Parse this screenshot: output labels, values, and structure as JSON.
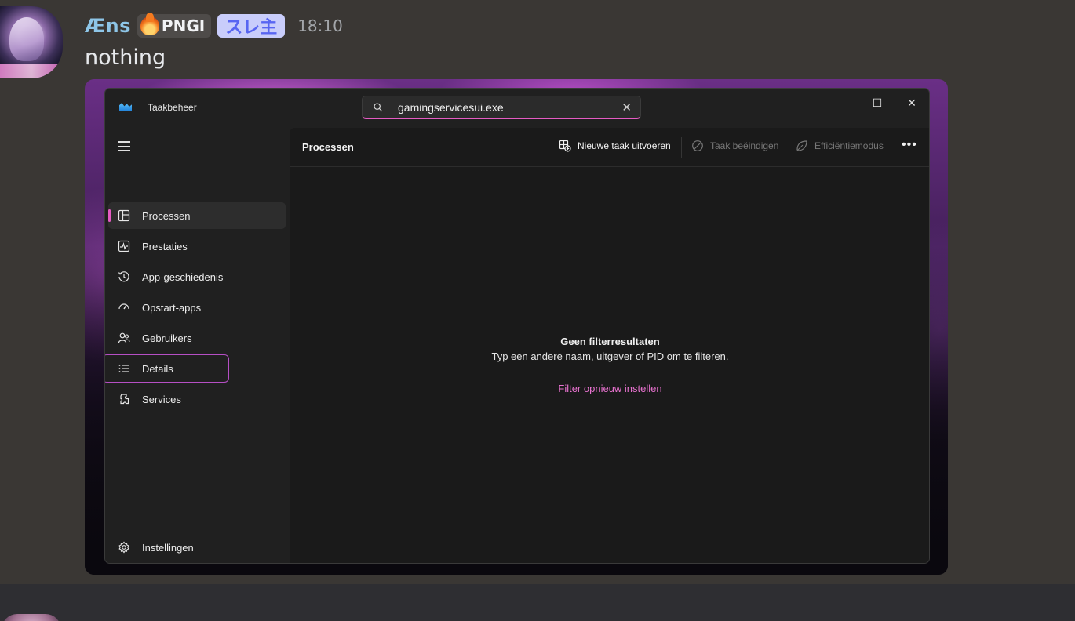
{
  "message": {
    "username": "Æns",
    "tag_label": "PNGI",
    "role_badge": "スレ主",
    "timestamp": "18:10",
    "text": "nothing"
  },
  "task_manager": {
    "app_title": "Taakbeheer",
    "search": {
      "value": "gamingservicesui.exe",
      "clear_glyph": "✕"
    },
    "window_controls": {
      "minimize": "—",
      "maximize": "☐",
      "close": "✕"
    },
    "sidebar": {
      "items": [
        {
          "label": "Processen",
          "icon": "processes-icon",
          "active": true
        },
        {
          "label": "Prestaties",
          "icon": "performance-icon"
        },
        {
          "label": "App-geschiedenis",
          "icon": "history-icon"
        },
        {
          "label": "Opstart-apps",
          "icon": "startup-icon"
        },
        {
          "label": "Gebruikers",
          "icon": "users-icon"
        },
        {
          "label": "Details",
          "icon": "details-icon",
          "highlighted": true
        },
        {
          "label": "Services",
          "icon": "services-icon"
        }
      ],
      "settings": {
        "label": "Instellingen",
        "icon": "gear-icon"
      }
    },
    "content": {
      "title": "Processen",
      "commands": {
        "new_task": "Nieuwe taak uitvoeren",
        "end_task": "Taak beëindigen",
        "efficiency": "Efficiëntiemodus",
        "more": "•••"
      },
      "empty_state": {
        "title": "Geen filterresultaten",
        "description": "Typ een andere naam, uitgever of PID om te filteren.",
        "reset_link": "Filter opnieuw instellen"
      }
    }
  },
  "colors": {
    "accent": "#e55bc3",
    "link": "#e872cf",
    "username": "#8ec6e8",
    "role_badge_bg": "#c9cdfb",
    "role_badge_text": "#5865f2"
  }
}
